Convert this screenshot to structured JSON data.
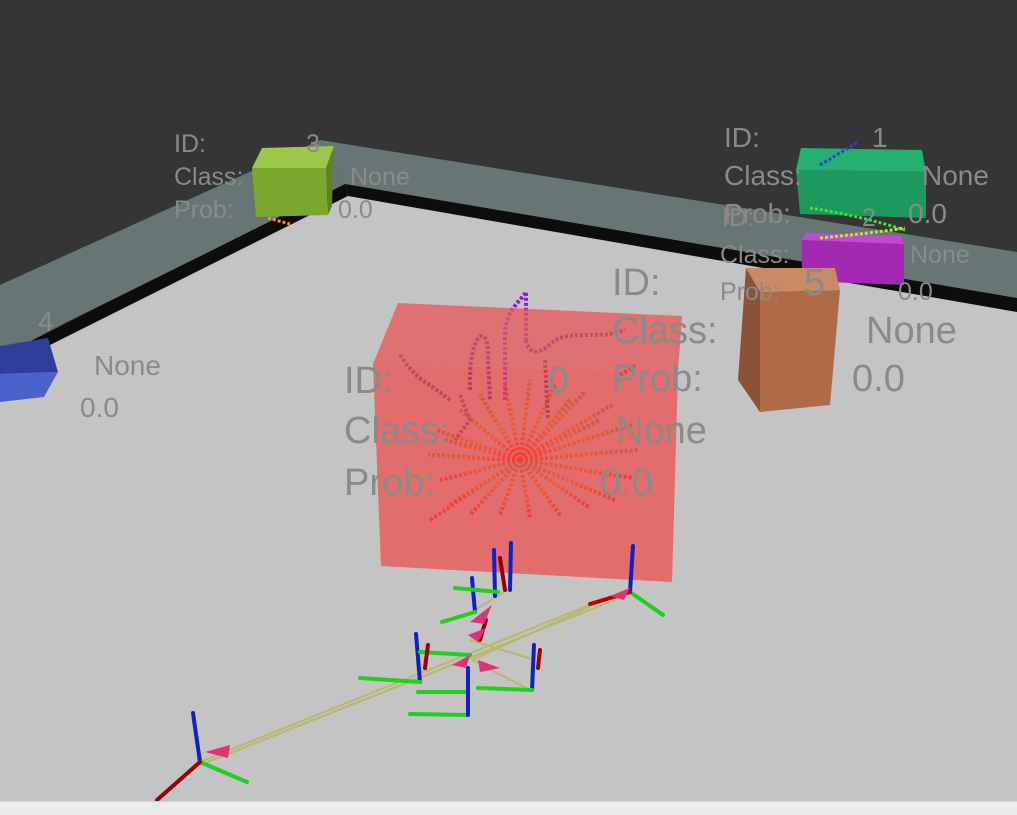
{
  "viewer": {
    "status_bar": ""
  },
  "objects": [
    {
      "id_label": "ID:",
      "id_value": "3",
      "class_label": "Class:",
      "class_value": "None",
      "prob_label": "Prob:",
      "prob_value": "0.0",
      "color": "#78a82c"
    },
    {
      "id_label": "ID:",
      "id_value": "1",
      "class_label": "Class:",
      "class_value": "None",
      "prob_label": "Prob:",
      "prob_value": "0.0",
      "color": "#1f9f62"
    },
    {
      "id_label": "ID:",
      "id_value": "2",
      "class_label": "Class:",
      "class_value": "None",
      "prob_label": "Prob:",
      "prob_value": "0.0",
      "color": "#a72ab4"
    },
    {
      "id_label": "",
      "id_value": "4",
      "class_label": "",
      "class_value": "None",
      "prob_label": "",
      "prob_value": "0.0",
      "color": "#3f56c4"
    },
    {
      "id_label": "ID:",
      "id_value": "5",
      "class_label": "Class:",
      "class_value": "None",
      "prob_label": "Prob:",
      "prob_value": "0.0",
      "color": "#b06a48"
    },
    {
      "id_label": "ID:",
      "id_value": "0",
      "class_label": "Class:",
      "class_value": "None",
      "prob_label": "Prob:",
      "prob_value": "0.0",
      "color": "#e25050"
    }
  ],
  "colors": {
    "floor": "#c4c4c4",
    "wall": "#677674",
    "wall_edge": "#0d0d0d",
    "sky": "#353535",
    "trajectory": "#b8b86a",
    "axis_x": "#9a0000",
    "axis_y": "#20d020",
    "axis_z": "#1020c8",
    "arrow_head": "#e0307a"
  }
}
